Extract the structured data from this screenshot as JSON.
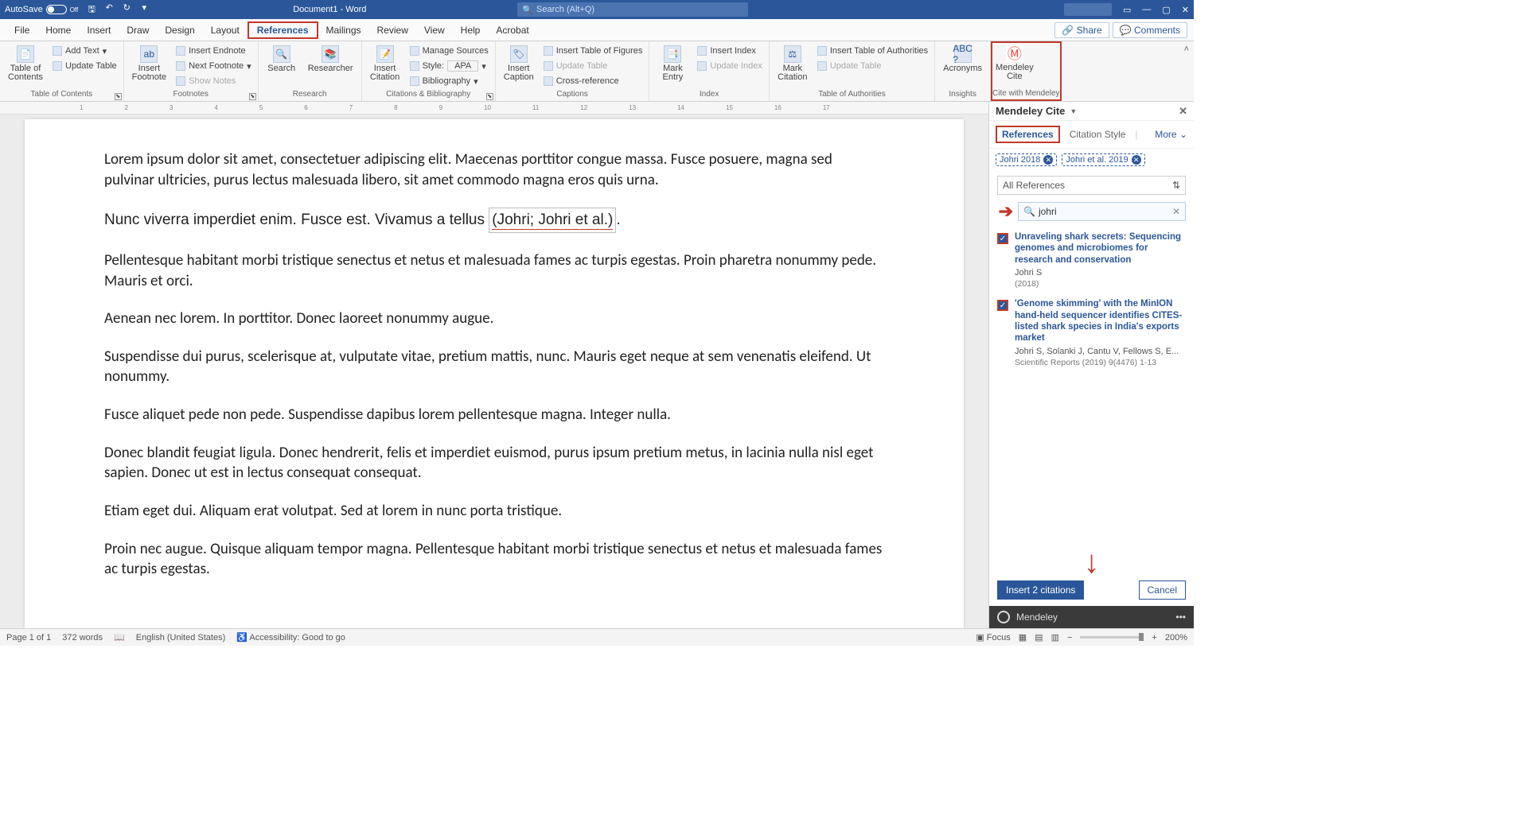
{
  "titlebar": {
    "autosave": "AutoSave",
    "autosave_state": "Off",
    "doc_title": "Document1 - Word",
    "search_placeholder": "Search (Alt+Q)"
  },
  "tabs": [
    "File",
    "Home",
    "Insert",
    "Draw",
    "Design",
    "Layout",
    "References",
    "Mailings",
    "Review",
    "View",
    "Help",
    "Acrobat"
  ],
  "active_tab": "References",
  "share": "Share",
  "comments": "Comments",
  "ribbon": {
    "toc": {
      "main": "Table of\nContents",
      "add": "Add Text",
      "update": "Update Table",
      "group": "Table of Contents"
    },
    "fn": {
      "main": "Insert\nFootnote",
      "endnote": "Insert Endnote",
      "next": "Next Footnote",
      "show": "Show Notes",
      "group": "Footnotes"
    },
    "res": {
      "search": "Search",
      "researcher": "Researcher",
      "group": "Research"
    },
    "cb": {
      "insert": "Insert\nCitation",
      "manage": "Manage Sources",
      "style_lbl": "Style:",
      "style_val": "APA",
      "bib": "Bibliography",
      "group": "Citations & Bibliography"
    },
    "cap": {
      "insert": "Insert\nCaption",
      "figs": "Insert Table of Figures",
      "update": "Update Table",
      "cross": "Cross-reference",
      "group": "Captions"
    },
    "idx": {
      "mark": "Mark\nEntry",
      "insert": "Insert Index",
      "update": "Update Index",
      "group": "Index"
    },
    "toa": {
      "mark": "Mark\nCitation",
      "insert": "Insert Table of Authorities",
      "update": "Update Table",
      "group": "Table of Authorities"
    },
    "ins": {
      "main": "Acronyms",
      "group": "Insights"
    },
    "mc": {
      "main": "Mendeley\nCite",
      "group": "Cite with Mendeley"
    }
  },
  "document": {
    "p1": "Lorem ipsum dolor sit amet, consectetuer adipiscing elit. Maecenas porttitor congue massa. Fusce posuere, magna sed pulvinar ultricies, purus lectus malesuada libero, sit amet commodo magna eros quis urna.",
    "p2a": "Nunc viverra imperdiet enim. Fusce est. Vivamus a tellus ",
    "citation": "(Johri; Johri et al.)",
    "p2b": ".",
    "p3": "Pellentesque habitant morbi tristique senectus et netus et malesuada fames ac turpis egestas. Proin pharetra nonummy pede. Mauris et orci.",
    "p4": "Aenean nec lorem. In porttitor. Donec laoreet nonummy augue.",
    "p5": "Suspendisse dui purus, scelerisque at, vulputate vitae, pretium mattis, nunc. Mauris eget neque at sem venenatis eleifend. Ut nonummy.",
    "p6": "Fusce aliquet pede non pede. Suspendisse dapibus lorem pellentesque magna. Integer nulla.",
    "p7": "Donec blandit feugiat ligula. Donec hendrerit, felis et imperdiet euismod, purus ipsum pretium metus, in lacinia nulla nisl eget sapien. Donec ut est in lectus consequat consequat.",
    "p8": "Etiam eget dui. Aliquam erat volutpat. Sed at lorem in nunc porta tristique.",
    "p9": "Proin nec augue. Quisque aliquam tempor magna. Pellentesque habitant morbi tristique senectus et netus et malesuada fames ac turpis egestas."
  },
  "panel": {
    "title": "Mendeley Cite",
    "tab_refs": "References",
    "tab_style": "Citation Style",
    "more": "More",
    "chips": [
      "Johri 2018",
      "Johri et al. 2019"
    ],
    "all_refs": "All References",
    "search_value": "johri",
    "results": [
      {
        "title": "Unraveling shark secrets: Sequencing genomes and microbiomes for research and conservation",
        "authors": "Johri S",
        "source": "(2018)"
      },
      {
        "title": "'Genome skimming' with the MinION hand-held sequencer identifies CITES-listed shark species in India's exports market",
        "authors": "Johri S, Solanki J, Cantu V, Fellows S, E...",
        "source": "Scientific Reports (2019) 9(4476) 1-13"
      }
    ],
    "insert": "Insert 2 citations",
    "cancel": "Cancel",
    "footer": "Mendeley"
  },
  "status": {
    "page": "Page 1 of 1",
    "words": "372 words",
    "lang": "English (United States)",
    "access": "Accessibility: Good to go",
    "focus": "Focus",
    "zoom": "200%"
  }
}
